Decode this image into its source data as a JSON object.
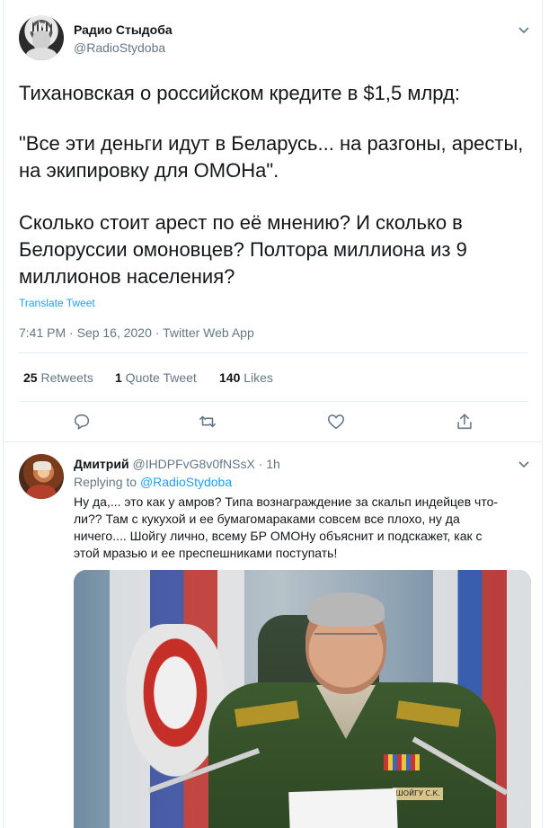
{
  "main_tweet": {
    "author_name": "Радио Стыдоба",
    "author_handle": "@RadioStydoba",
    "lines": [
      "Тихановская о российском кредите в $1,5 млрд:",
      "\"Все эти деньги идут в Беларусь... на разгоны, аресты,",
      "на экипировку для ОМОНа\".",
      "Сколько стоит арест по её мнению? И сколько в",
      "Белоруссии омоновцев? Полтора миллиона из 9",
      "миллионов населения?"
    ],
    "translate_label": "Translate Tweet",
    "meta": "7:41 PM · Sep 16, 2020 · Twitter Web App",
    "stats": {
      "retweets_count": "25",
      "retweets_label": " Retweets",
      "quote_count": "1",
      "quote_label": " Quote Tweet",
      "likes_count": "140",
      "likes_label": " Likes"
    },
    "actions": [
      "reply-icon",
      "retweet-icon",
      "like-icon",
      "share-icon"
    ]
  },
  "reply": {
    "author_name": "Дмитрий",
    "author_handle_time": " @IHDPFvG8v0fNSsX · 1h",
    "replying_prefix": "Replying to ",
    "replying_to": "@RadioStydoba",
    "lines": [
      "Ну да,... это как у амров?  Типа вознаграждение за скальп индейцев что-",
      "ли??  Там с кукухой и ее бумагомараками совсем все плохо, ну да",
      "ничего.... Шойгу лично,  всему  БР  ОМОНу объяснит и подскажет, как с",
      "этой мразью и ее преспешниками поступать!"
    ],
    "photo_nameplate": "ШОЙГУ С.К."
  },
  "colors": {
    "link": "#1da1f2",
    "secondary_text": "#657786",
    "border": "#e6ecf0"
  }
}
